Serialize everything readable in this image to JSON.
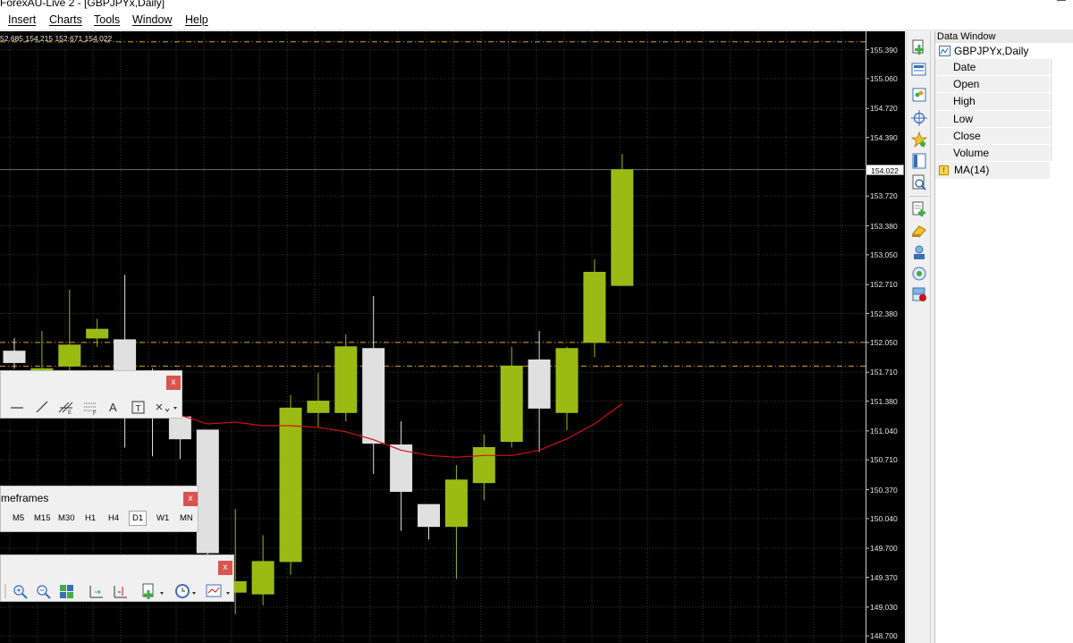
{
  "window": {
    "title": "ForexAU-Live 2 - [GBPJPYx,Daily]"
  },
  "menu": [
    "Insert",
    "Charts",
    "Tools",
    "Window",
    "Help"
  ],
  "chart": {
    "ohlc": "52.685 154.215 152.671 154.022",
    "current_price": "154.022",
    "price_levels": [
      "155.390",
      "155.060",
      "154.720",
      "154.390",
      "153.720",
      "153.380",
      "153.050",
      "152.710",
      "152.380",
      "152.050",
      "151.710",
      "151.380",
      "151.040",
      "150.710",
      "150.370",
      "150.040",
      "149.700",
      "149.370",
      "149.030",
      "148.700"
    ],
    "colors": {
      "background": "#000000",
      "bull": "#9bbb14",
      "bear": "#e0e0e0",
      "ma": "#d01010",
      "level_line": "#e0a020"
    }
  },
  "chart_data": {
    "type": "candlestick",
    "ylim": [
      148.62,
      155.6
    ],
    "candles": [
      {
        "o": 151.95,
        "h": 152.1,
        "l": 151.75,
        "c": 151.82
      },
      {
        "o": 151.73,
        "h": 152.18,
        "l": 151.65,
        "c": 151.75
      },
      {
        "o": 151.78,
        "h": 152.65,
        "l": 151.55,
        "c": 152.02
      },
      {
        "o": 152.1,
        "h": 152.32,
        "l": 152.0,
        "c": 152.2
      },
      {
        "o": 152.08,
        "h": 152.82,
        "l": 150.85,
        "c": 151.6
      },
      {
        "o": 151.55,
        "h": 151.75,
        "l": 150.75,
        "c": 151.25
      },
      {
        "o": 151.2,
        "h": 151.6,
        "l": 150.72,
        "c": 150.95
      },
      {
        "o": 151.05,
        "h": 151.05,
        "l": 149.55,
        "c": 149.65
      },
      {
        "o": 149.2,
        "h": 150.15,
        "l": 148.95,
        "c": 149.32
      },
      {
        "o": 149.18,
        "h": 149.85,
        "l": 149.05,
        "c": 149.55
      },
      {
        "o": 149.55,
        "h": 151.45,
        "l": 149.4,
        "c": 151.3
      },
      {
        "o": 151.25,
        "h": 151.7,
        "l": 151.08,
        "c": 151.38
      },
      {
        "o": 151.25,
        "h": 152.14,
        "l": 151.15,
        "c": 152.0
      },
      {
        "o": 151.98,
        "h": 152.58,
        "l": 150.55,
        "c": 150.9
      },
      {
        "o": 150.88,
        "h": 151.15,
        "l": 149.9,
        "c": 150.35
      },
      {
        "o": 150.2,
        "h": 150.2,
        "l": 149.8,
        "c": 149.95
      },
      {
        "o": 149.95,
        "h": 150.65,
        "l": 149.35,
        "c": 150.48
      },
      {
        "o": 150.45,
        "h": 151.0,
        "l": 150.25,
        "c": 150.85
      },
      {
        "o": 150.92,
        "h": 152.0,
        "l": 150.85,
        "c": 151.78
      },
      {
        "o": 151.85,
        "h": 152.18,
        "l": 150.8,
        "c": 151.3
      },
      {
        "o": 151.25,
        "h": 152.0,
        "l": 151.05,
        "c": 151.98
      },
      {
        "o": 152.05,
        "h": 153.0,
        "l": 151.88,
        "c": 152.85
      },
      {
        "o": 152.7,
        "h": 154.2,
        "l": 152.7,
        "c": 154.02
      }
    ],
    "ma": {
      "name": "MA(14)",
      "values": [
        151.66,
        151.66,
        151.64,
        151.6,
        151.5,
        151.32,
        151.22,
        151.12,
        151.14,
        151.1,
        151.1,
        151.08,
        151.03,
        150.94,
        150.82,
        150.76,
        150.74,
        150.76,
        150.76,
        150.82,
        150.95,
        151.12,
        151.35
      ]
    },
    "levels": [
      155.48,
      152.05,
      151.78
    ]
  },
  "data_window": {
    "title": "Data Window",
    "symbol": "GBPJPYx,Daily",
    "rows": [
      "Date",
      "Open",
      "High",
      "Low",
      "Close",
      "Volume"
    ],
    "indicator": "MA(14)"
  },
  "timeframes_panel": {
    "title": "meframes",
    "close": "x",
    "items": [
      "M5",
      "M15",
      "M30",
      "H1",
      "H4",
      "D1",
      "W1",
      "MN"
    ],
    "active": "D1"
  },
  "drawing_panel": {
    "close": "x",
    "text_tool": "A"
  },
  "standard_panel": {
    "close": "x"
  }
}
